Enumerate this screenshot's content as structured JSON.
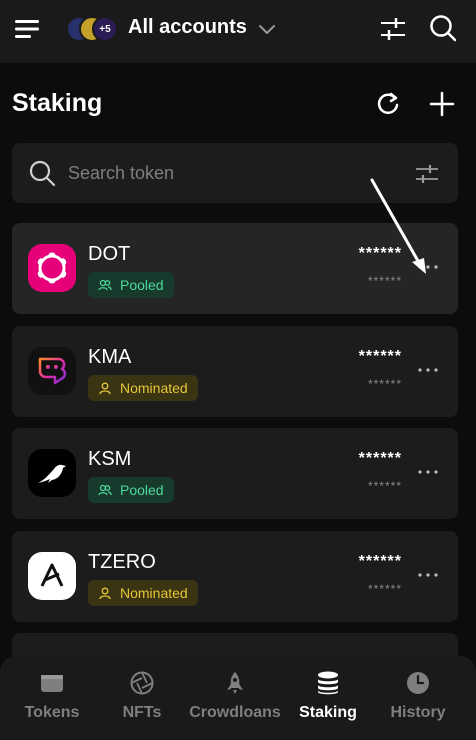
{
  "header": {
    "account_title": "All accounts",
    "extra_accounts_badge": "+5",
    "icons": [
      "menu-icon",
      "chevron-down-icon",
      "filter-icon",
      "search-icon"
    ]
  },
  "page": {
    "title": "Staking",
    "icons": [
      "reload-icon",
      "plus-icon"
    ]
  },
  "search": {
    "placeholder": "Search token"
  },
  "items": [
    {
      "symbol": "DOT",
      "status": "Pooled",
      "balance_masked": "******",
      "value_masked": "******",
      "logo_color": "#e6007a"
    },
    {
      "symbol": "KMA",
      "status": "Nominated",
      "balance_masked": "******",
      "value_masked": "******",
      "logo_color": "#111111"
    },
    {
      "symbol": "KSM",
      "status": "Pooled",
      "balance_masked": "******",
      "value_masked": "******",
      "logo_color": "#000000"
    },
    {
      "symbol": "TZERO",
      "status": "Nominated",
      "balance_masked": "******",
      "value_masked": "******",
      "logo_color": "#ffffff"
    }
  ],
  "tabs": [
    {
      "label": "Tokens",
      "icon": "wallet-icon",
      "active": false
    },
    {
      "label": "NFTs",
      "icon": "aperture-icon",
      "active": false
    },
    {
      "label": "Crowdloans",
      "icon": "rocket-icon",
      "active": false
    },
    {
      "label": "Staking",
      "icon": "database-icon",
      "active": true
    },
    {
      "label": "History",
      "icon": "clock-icon",
      "active": false
    }
  ],
  "colors": {
    "background": "#0c0c0c",
    "surface": "#1c1c1c",
    "pooled_text": "#4cd99b",
    "pooled_bg": "#173a2c",
    "nominated_text": "#e6c73a",
    "nominated_bg": "#3a3412"
  }
}
